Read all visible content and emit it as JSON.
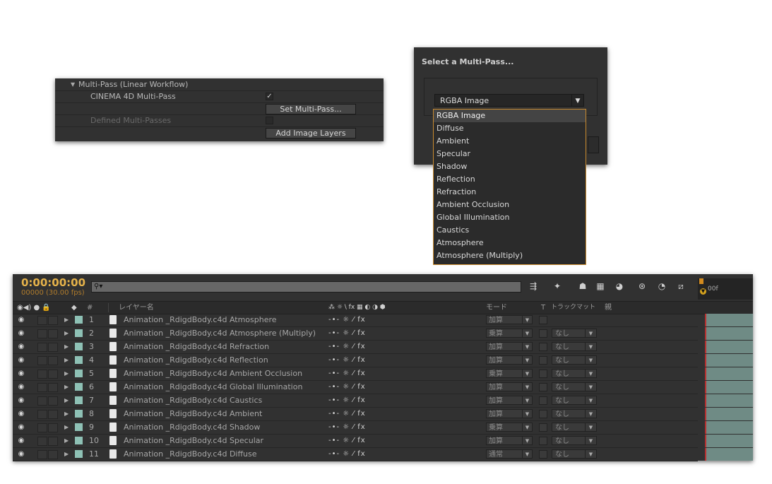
{
  "multipass_panel": {
    "section_label": "Multi-Pass (Linear Workflow)",
    "c4d_label": "CINEMA 4D Multi-Pass",
    "c4d_checked": "✓",
    "set_button": "Set Multi-Pass...",
    "defined_label": "Defined Multi-Passes",
    "add_button": "Add Image Layers"
  },
  "dialog": {
    "title": "Select a Multi-Pass...",
    "selected": "RGBA Image",
    "options": [
      "RGBA Image",
      "Diffuse",
      "Ambient",
      "Specular",
      "Shadow",
      "Reflection",
      "Refraction",
      "Ambient Occlusion",
      "Global Illumination",
      "Caustics",
      "Atmosphere",
      "Atmosphere (Multiply)"
    ]
  },
  "timeline": {
    "timecode": "0:00:00:00",
    "fps": "00000 (30.00 fps)",
    "search_placeholder": "",
    "ruler_label": "00f",
    "headers": {
      "num": "#",
      "layer_name": "レイヤー名",
      "mode": "モード",
      "t": "T",
      "trackmatte": "トラックマット",
      "parent": "親",
      "switches": "⁂ ☼ \\ fx ▦ ◐ ◑ ⬢"
    },
    "layers": [
      {
        "num": "1",
        "name": "Animation _RdigdBody.c4d Atmosphere",
        "mode": "加算",
        "trackmatte": ""
      },
      {
        "num": "2",
        "name": "Animation _RdigdBody.c4d Atmosphere (Multiply)",
        "mode": "乗算",
        "trackmatte": "なし"
      },
      {
        "num": "3",
        "name": "Animation _RdigdBody.c4d Refraction",
        "mode": "加算",
        "trackmatte": "なし"
      },
      {
        "num": "4",
        "name": "Animation _RdigdBody.c4d Reflection",
        "mode": "加算",
        "trackmatte": "なし"
      },
      {
        "num": "5",
        "name": "Animation _RdigdBody.c4d Ambient Occlusion",
        "mode": "乗算",
        "trackmatte": "なし"
      },
      {
        "num": "6",
        "name": "Animation _RdigdBody.c4d Global Illumination",
        "mode": "加算",
        "trackmatte": "なし"
      },
      {
        "num": "7",
        "name": "Animation _RdigdBody.c4d Caustics",
        "mode": "加算",
        "trackmatte": "なし"
      },
      {
        "num": "8",
        "name": "Animation _RdigdBody.c4d Ambient",
        "mode": "加算",
        "trackmatte": "なし"
      },
      {
        "num": "9",
        "name": "Animation _RdigdBody.c4d Shadow",
        "mode": "乗算",
        "trackmatte": "なし"
      },
      {
        "num": "10",
        "name": "Animation _RdigdBody.c4d Specular",
        "mode": "加算",
        "trackmatte": "なし"
      },
      {
        "num": "11",
        "name": "Animation _RdigdBody.c4d Diffuse",
        "mode": "通常",
        "trackmatte": "なし"
      }
    ],
    "layer_switches": "-•- ☼ ⁄ fx",
    "label_color": "#8ec1b5",
    "timecode_color": "#e5b24a"
  }
}
